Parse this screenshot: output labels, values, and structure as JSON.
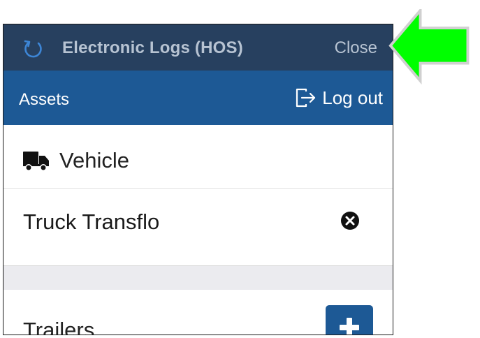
{
  "header": {
    "title": "Electronic Logs (HOS)",
    "close_label": "Close"
  },
  "subheader": {
    "assets_label": "Assets",
    "logout_label": "Log out"
  },
  "vehicle": {
    "section_label": "Vehicle",
    "name": "Truck Transflo"
  },
  "trailers": {
    "section_label": "Trailers"
  },
  "colors": {
    "title_bar": "#27405f",
    "sub_bar": "#1d5995",
    "arrow": "#00ff00"
  },
  "icons": {
    "refresh": "refresh-icon",
    "logout": "logout-icon",
    "truck": "truck-icon",
    "remove": "close-circle-icon",
    "add": "plus-icon",
    "pointer": "arrow-left-icon"
  }
}
